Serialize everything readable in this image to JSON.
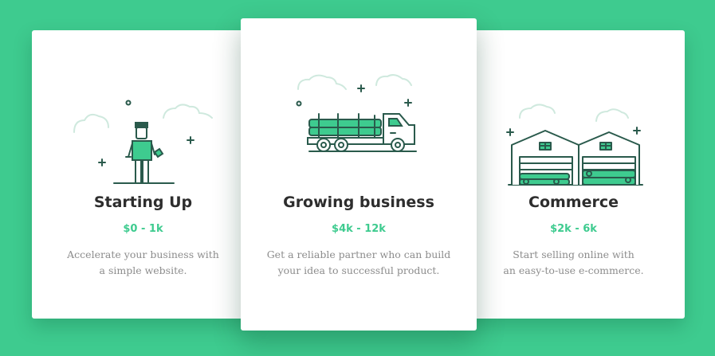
{
  "plans": [
    {
      "title": "Starting Up",
      "price": "$0 - 1k",
      "desc_line1": "Accelerate your business with",
      "desc_line2": "a simple website.",
      "illustration": "person-icon"
    },
    {
      "title": "Growing business",
      "price": "$4k - 12k",
      "desc_line1": "Get a reliable partner who can build",
      "desc_line2": "your idea to successful product.",
      "illustration": "truck-icon"
    },
    {
      "title": "Commerce",
      "price": "$2k - 6k",
      "desc_line1": "Start selling online with",
      "desc_line2": "an easy-to-use e-commerce.",
      "illustration": "warehouse-icon"
    }
  ],
  "colors": {
    "background": "#3ecb8f",
    "accent": "#3ecb8f",
    "outline": "#2a5a4c",
    "cloud": "#cfe9de"
  }
}
